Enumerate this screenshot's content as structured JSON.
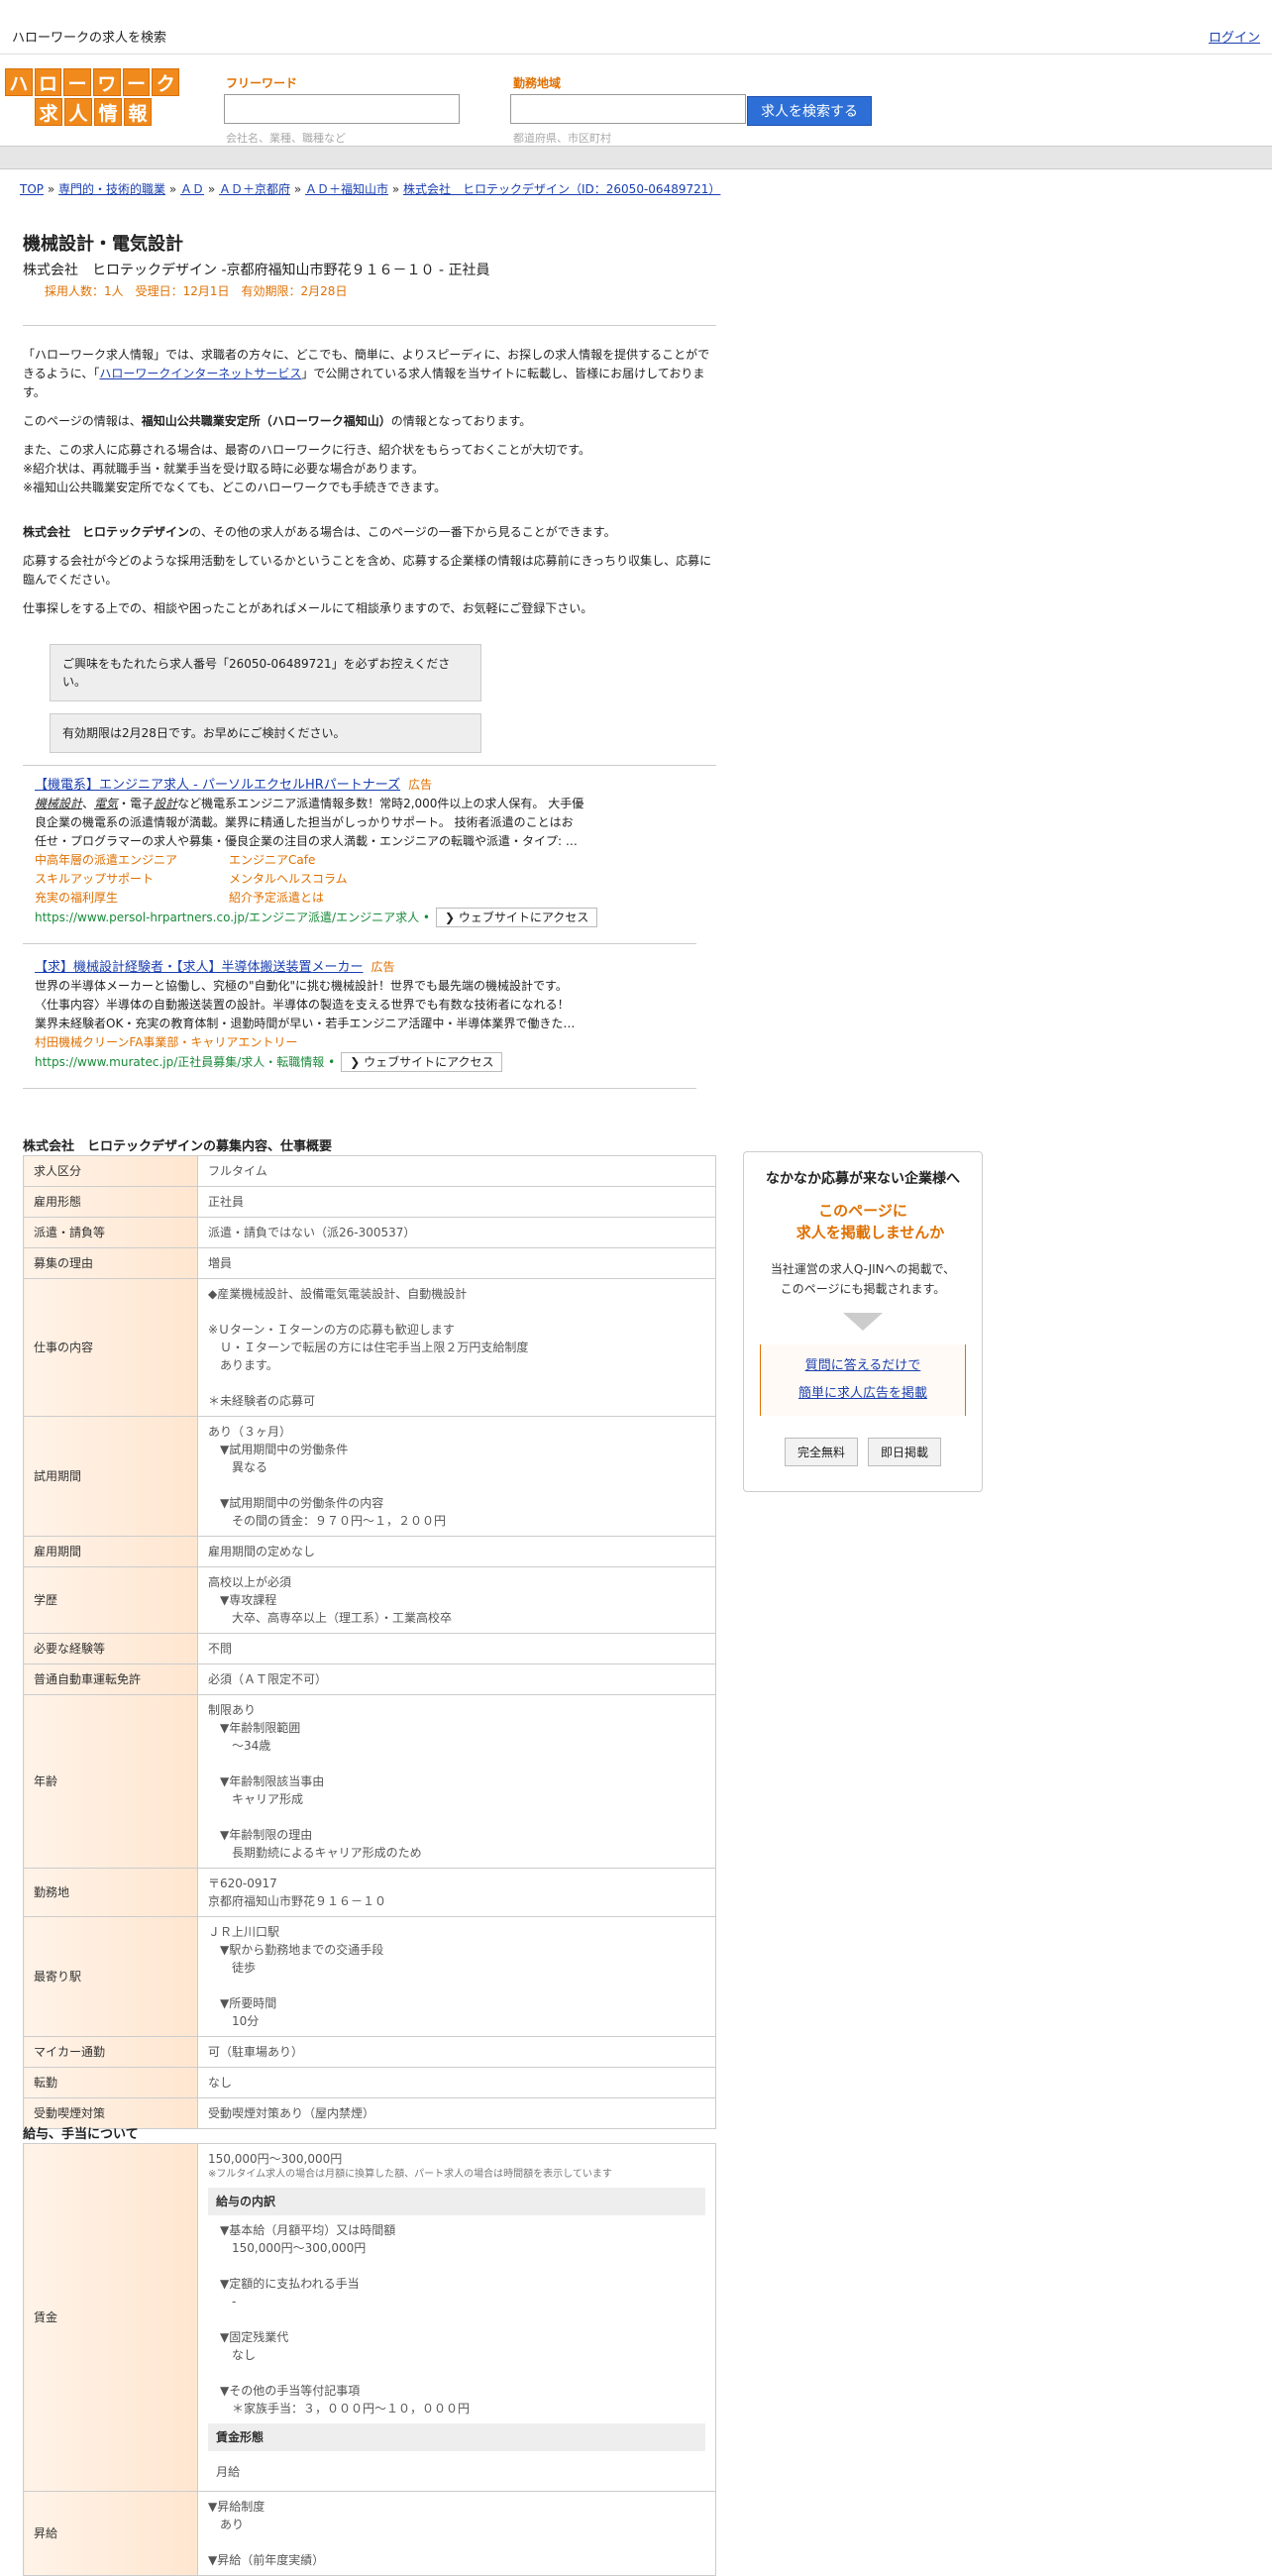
{
  "top": {
    "title": "ハローワークの求人を検索",
    "login": "ログイン"
  },
  "logo": {
    "row1": [
      "ハ",
      "ロ",
      "ー",
      "ワ",
      "ー",
      "ク"
    ],
    "row2": [
      "求",
      "人",
      "情",
      "報"
    ]
  },
  "search": {
    "keyword_label": "フリーワード",
    "keyword_hint": "会社名、業種、職種など",
    "area_label": "勤務地域",
    "area_hint": "都道府県、市区町村",
    "button": "求人を検索する"
  },
  "breadcrumb": [
    "TOP",
    "専門的・技術的職業",
    "ＡＤ",
    "ＡＤ＋京都府",
    "ＡＤ＋福知山市",
    "株式会社　ヒロテックデザイン（ID：26050-06489721）"
  ],
  "job": {
    "title": "機械設計・電気設計",
    "company_line": "株式会社　ヒロテックデザイン -京都府福知山市野花９１６－１０ - 正社員",
    "meta": "採用人数：1人　受理日：12月1日　有効期限：2月28日"
  },
  "intro": {
    "p1_a": "「ハローワーク求人情報」では、求職者の方々に、どこでも、簡単に、よりスピーディに、お探しの求人情報を提供することができるように、「",
    "p1_link": "ハローワークインターネットサービス",
    "p1_b": "」で公開されている求人情報を当サイトに転載し、皆様にお届けしております。",
    "p2_a": "このページの情報は、",
    "p2_b": "福知山公共職業安定所（ハローワーク福知山）",
    "p2_c": "の情報となっております。",
    "p3": "また、この求人に応募される場合は、最寄のハローワークに行き、紹介状をもらっておくことが大切です。",
    "p4": "※紹介状は、再就職手当・就業手当を受け取る時に必要な場合があります。",
    "p5": "※福知山公共職業安定所でなくても、どこのハローワークでも手続きできます。",
    "p6_a": "株式会社　ヒロテックデザイン",
    "p6_b": "の、その他の求人がある場合は、このページの一番下から見ることができます。",
    "p7": "応募する会社が今どのような採用活動をしているかということを含め、応募する企業様の情報は応募前にきっちり収集し、応募に臨んでください。",
    "p8": "仕事探しをする上での、相談や困ったことがあればメールにて相談承りますので、お気軽にご登録下さい。",
    "notice1": "ご興味をもたれたら求人番号「26050-06489721」を必ずお控えください。",
    "notice2": "有効期限は2月28日です。お早めにご検討ください。"
  },
  "ads": [
    {
      "title": "【機電系】エンジニア求人 - パーソルエクセルHRパートナーズ",
      "tag": "広告",
      "body1_pre": "",
      "body1_em1": "機械設計",
      "body1_mid1": "、",
      "body1_em2": "電気",
      "body1_mid2": "・電子",
      "body1_em3": "設計",
      "body1_rest": "など機電系エンジニア派遣情報多数！常時2,000件以上の求人保有。 大手優",
      "body2": "良企業の機電系の派遣情報が満載。業界に精通した担当がしっかりサポート。 技術者派遣のことはお",
      "body3": "任せ・プログラマーの求人や募集・優良企業の注目の求人満載・エンジニアの転職や派遣・タイプ: …",
      "links": [
        "中高年層の派遣エンジニア",
        "エンジニアCafe",
        "スキルアップサポート",
        "メンタルヘルスコラム",
        "充実の福利厚生",
        "紹介予定派遣とは"
      ],
      "url": "https://www.persol-hrpartners.co.jp/エンジニア派遣/エンジニア求人",
      "visit": "❯ ウェブサイトにアクセス"
    },
    {
      "title": "【求】機械設計経験者・【求人】半導体搬送装置メーカー",
      "tag": "広告",
      "body1": "世界の半導体メーカーと協働し、究極の\"自動化\"に挑む機械設計！世界でも最先端の機械設計です。",
      "body2": "〈仕事内容〉半導体の自動搬送装置の設計。半導体の製造を支える世界でも有数な技術者になれる！",
      "body3": "業界未経験者OK・充実の教育体制・退勤時間が早い・若手エンジニア活躍中・半導体業界で働きた…",
      "sponsor": "村田機械クリーンFA事業部・キャリアエントリー",
      "url": "https://www.muratec.jp/正社員募集/求人・転職情報",
      "visit": "❯ ウェブサイトにアクセス"
    }
  ],
  "details": {
    "section_title": "株式会社　ヒロテックデザインの募集内容、仕事概要",
    "rows": [
      {
        "h": "求人区分",
        "v": [
          "フルタイム"
        ]
      },
      {
        "h": "雇用形態",
        "v": [
          "正社員"
        ]
      },
      {
        "h": "派遣・請負等",
        "v": [
          "派遣・請負ではない（派26-300537）"
        ]
      },
      {
        "h": "募集の理由",
        "v": [
          "増員"
        ]
      },
      {
        "h": "仕事の内容",
        "v": [
          "◆産業機械設計、設備電気電装設計、自動機設計",
          "",
          "※Ｕターン・Ｉターンの方の応募も歓迎します",
          "　Ｕ・Ｉターンで転居の方には住宅手当上限２万円支給制度",
          "　あります。",
          "",
          "＊未経験者の応募可"
        ]
      },
      {
        "h": "試用期間",
        "v": [
          "あり（３ヶ月）",
          "　▼試用期間中の労働条件",
          "　　異なる",
          "",
          "　▼試用期間中の労働条件の内容",
          "　　その間の賃金：９７０円～１，２００円"
        ]
      },
      {
        "h": "雇用期間",
        "v": [
          "雇用期間の定めなし"
        ]
      },
      {
        "h": "学歴",
        "v": [
          "高校以上が必須",
          "　▼専攻課程",
          "　　大卒、高専卒以上（理工系）・工業高校卒"
        ]
      },
      {
        "h": "必要な経験等",
        "v": [
          "不問"
        ]
      },
      {
        "h": "普通自動車運転免許",
        "v": [
          "必須（ＡＴ限定不可）"
        ]
      },
      {
        "h": "年齢",
        "v": [
          "制限あり",
          "　▼年齢制限範囲",
          "　　～34歳",
          "",
          "　▼年齢制限該当事由",
          "　　キャリア形成",
          "",
          "　▼年齢制限の理由",
          "　　長期勤続によるキャリア形成のため"
        ]
      },
      {
        "h": "勤務地",
        "v": [
          "〒620-0917",
          "京都府福知山市野花９１６－１０"
        ]
      },
      {
        "h": "最寄り駅",
        "v": [
          "ＪＲ上川口駅",
          "　▼駅から勤務地までの交通手段",
          "　　徒歩",
          "",
          "　▼所要時間",
          "　　10分"
        ]
      },
      {
        "h": "マイカー通勤",
        "v": [
          "可（駐車場あり）"
        ]
      },
      {
        "h": "転勤",
        "v": [
          "なし"
        ]
      },
      {
        "h": "受動喫煙対策",
        "v": [
          "受動喫煙対策あり（屋内禁煙）"
        ]
      }
    ]
  },
  "salary": {
    "section_title": "給与、手当について",
    "wage_h": "賃金",
    "wage_range": "150,000円〜300,000円",
    "wage_note": "※フルタイム求人の場合は月額に換算した額、パート求人の場合は時間額を表示しています",
    "breakdown_h": "給与の内訳",
    "breakdown": [
      "▼基本給（月額平均）又は時間額",
      "　150,000円〜300,000円",
      "",
      "▼定額的に支払われる手当",
      "　-",
      "",
      "▼固定残業代",
      "　なし",
      "",
      "▼その他の手当等付記事項",
      "　＊家族手当：３，０００円～１０，０００円"
    ],
    "form_h": "賃金形態",
    "form": "月給",
    "raise_h": "昇給",
    "raise": [
      "▼昇給制度",
      "　あり",
      "",
      "▼昇給（前年度実績）"
    ]
  },
  "sidebar": {
    "heading": "なかなか応募が来ない企業様へ",
    "orange1": "このページに",
    "orange2": "　求人を掲載しませんか",
    "desc1": "当社運営の求人Q-JINへの掲載で、",
    "desc2": "このページにも掲載されます。",
    "link1": "質問に答えるだけで",
    "link2": "簡単に求人広告を掲載",
    "btn1": "完全無料",
    "btn2": "即日掲載"
  }
}
